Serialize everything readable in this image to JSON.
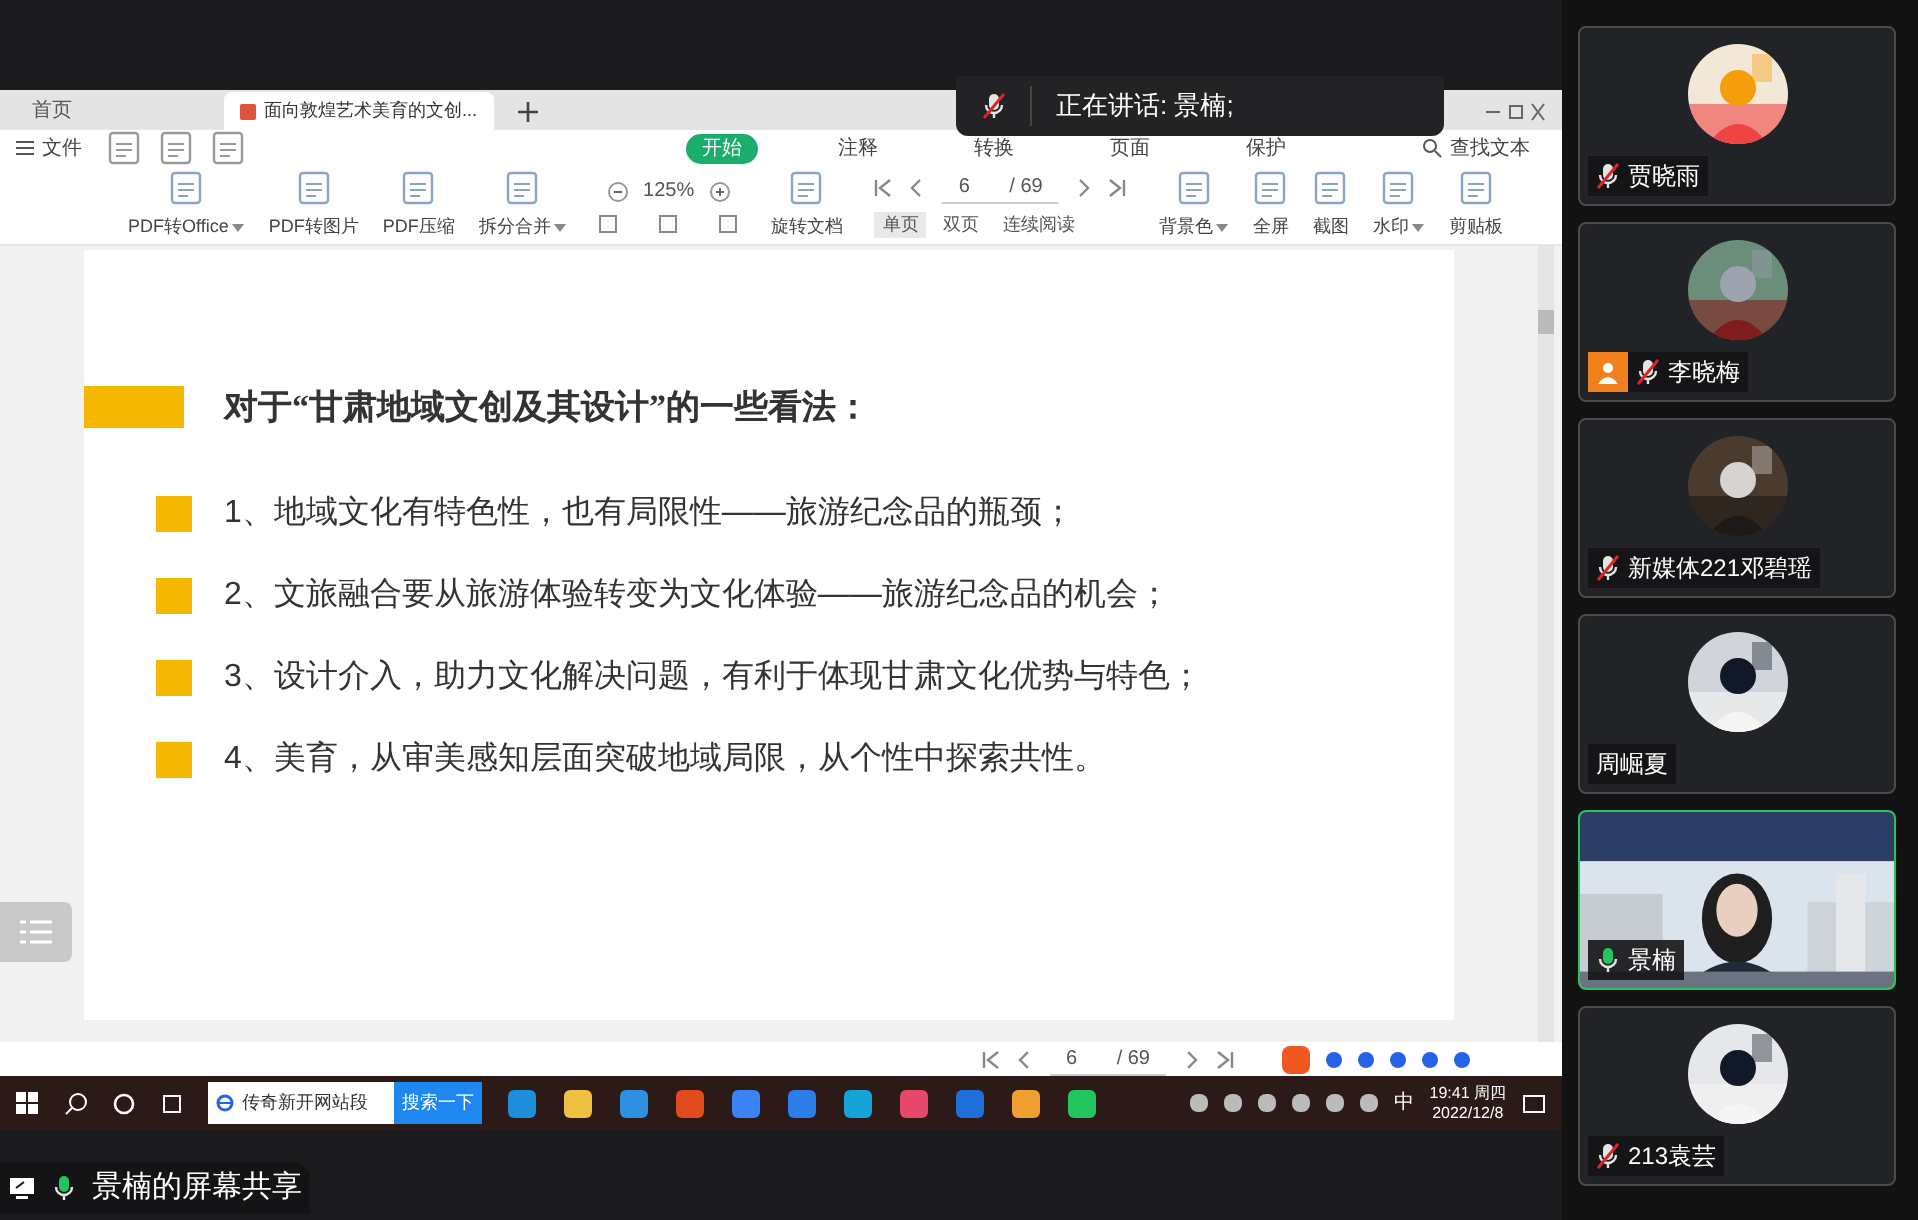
{
  "tabs": [
    {
      "label": "首页",
      "selected": false
    },
    {
      "label": "面向敦煌艺术美育的文创...",
      "selected": true
    }
  ],
  "menu": {
    "file": "文件",
    "ribbon_tabs": [
      {
        "label": "开始",
        "selected": true
      },
      {
        "label": "注释",
        "selected": false
      },
      {
        "label": "转换",
        "selected": false
      },
      {
        "label": "页面",
        "selected": false
      },
      {
        "label": "保护",
        "selected": false
      }
    ],
    "find": "查找文本"
  },
  "toolbar": {
    "left": [
      {
        "label": "PDF转Office",
        "dropdown": true
      },
      {
        "label": "PDF转图片",
        "dropdown": false
      },
      {
        "label": "PDF压缩",
        "dropdown": false
      },
      {
        "label": "拆分合并",
        "dropdown": true
      }
    ],
    "zoom": "125%",
    "rotate": "旋转文档",
    "page": "6",
    "pages": "/ 69",
    "view_modes": [
      {
        "label": "单页",
        "selected": true
      },
      {
        "label": "双页",
        "selected": false
      },
      {
        "label": "连续阅读",
        "selected": false
      }
    ],
    "right": [
      {
        "label": "背景色",
        "dropdown": true
      },
      {
        "label": "全屏",
        "dropdown": false
      },
      {
        "label": "截图",
        "dropdown": false
      },
      {
        "label": "水印",
        "dropdown": true
      },
      {
        "label": "剪贴板",
        "dropdown": false
      }
    ]
  },
  "speaker_banner": "正在讲话: 景楠;",
  "slide": {
    "heading": "对于“甘肃地域文创及其设计”的一些看法：",
    "bullets": [
      "1、地域文化有特色性，也有局限性——旅游纪念品的瓶颈；",
      "2、文旅融合要从旅游体验转变为文化体验——旅游纪念品的机会；",
      "3、设计介入，助力文化解决问题，有利于体现甘肃文化优势与特色；",
      "4、美育，从审美感知层面突破地域局限，从个性中探索共性。"
    ]
  },
  "page_nav": {
    "page": "6",
    "pages": "/ 69"
  },
  "taskbar": {
    "search": "传奇新开网站段",
    "search_button": "搜索一下",
    "ime": "中",
    "time": "19:41 周四",
    "date": "2022/12/8"
  },
  "share_label": "景楠的屏幕共享",
  "participants": [
    {
      "name": "贾晓雨",
      "muted": true,
      "speaking": false,
      "host": false,
      "active": false,
      "kind": "avatar"
    },
    {
      "name": "李晓梅",
      "muted": true,
      "speaking": false,
      "host": true,
      "active": false,
      "kind": "avatar"
    },
    {
      "name": "新媒体221邓碧瑶",
      "muted": true,
      "speaking": false,
      "host": false,
      "active": false,
      "kind": "avatar"
    },
    {
      "name": "周崛夏",
      "muted": false,
      "speaking": false,
      "host": false,
      "active": false,
      "kind": "avatar"
    },
    {
      "name": "景楠",
      "muted": false,
      "speaking": true,
      "host": false,
      "active": true,
      "kind": "video"
    },
    {
      "name": "213袁芸",
      "muted": true,
      "speaking": false,
      "host": false,
      "active": false,
      "kind": "avatar"
    }
  ]
}
